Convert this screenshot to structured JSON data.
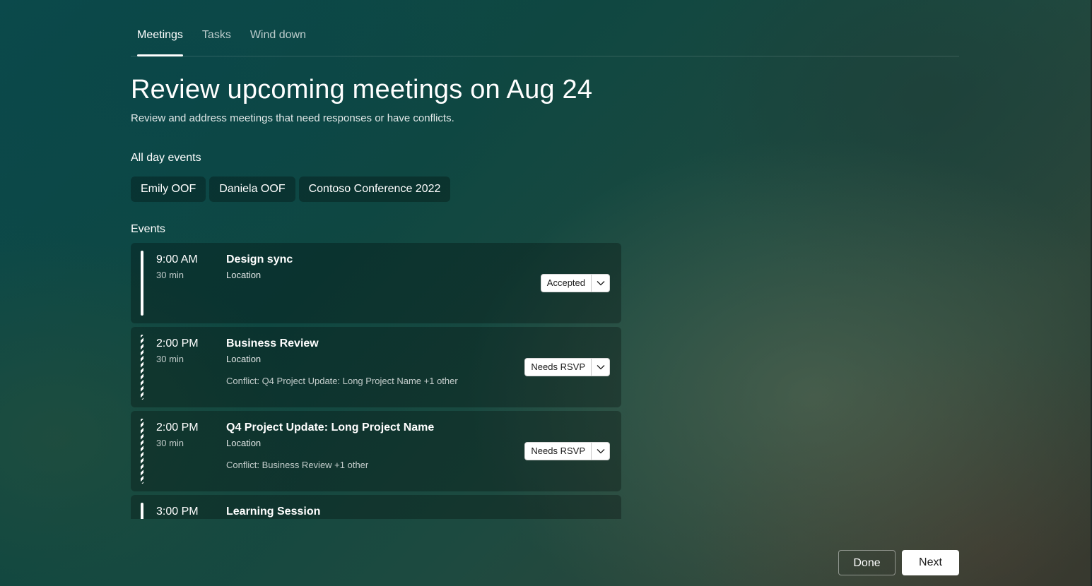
{
  "tabs": [
    {
      "label": "Meetings",
      "active": true
    },
    {
      "label": "Tasks",
      "active": false
    },
    {
      "label": "Wind down",
      "active": false
    }
  ],
  "header": {
    "title": "Review upcoming meetings on Aug 24",
    "subtitle": "Review and address meetings that need responses or have conflicts."
  },
  "all_day": {
    "label": "All day events",
    "chips": [
      "Emily OOF",
      "Daniela OOF",
      "Contoso Conference 2022"
    ]
  },
  "events": {
    "label": "Events",
    "items": [
      {
        "time": "9:00 AM",
        "duration": "30 min",
        "title": "Design sync",
        "location": "Location",
        "conflict": "",
        "status": "Accepted",
        "bar_style": "solid"
      },
      {
        "time": "2:00 PM",
        "duration": "30 min",
        "title": "Business Review",
        "location": "Location",
        "conflict": "Conflict: Q4 Project Update: Long Project Name +1 other",
        "status": "Needs RSVP",
        "bar_style": "tentative"
      },
      {
        "time": "2:00 PM",
        "duration": "30 min",
        "title": "Q4 Project Update: Long Project Name",
        "location": "Location",
        "conflict": "Conflict: Business Review +1 other",
        "status": "Needs RSVP",
        "bar_style": "tentative"
      },
      {
        "time": "3:00 PM",
        "duration": "",
        "title": "Learning Session",
        "location": "",
        "conflict": "",
        "status": "",
        "bar_style": "solid"
      }
    ]
  },
  "footer": {
    "done_label": "Done",
    "next_label": "Next"
  },
  "icons": {
    "rsvp_dropdown": "chevron-down-icon"
  },
  "colors": {
    "background": "#0f4741",
    "card": "#0c2f2c",
    "button_primary": "#ffffff"
  }
}
